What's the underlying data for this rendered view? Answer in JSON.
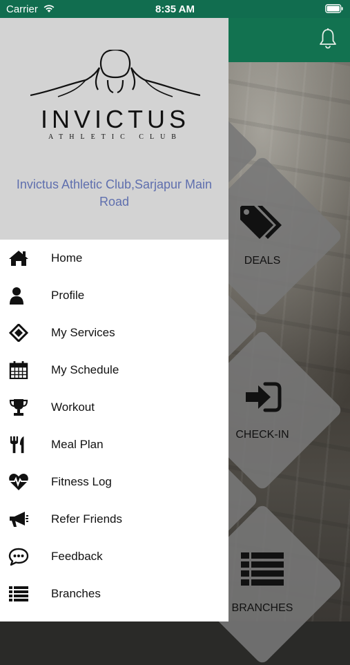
{
  "status_bar": {
    "carrier": "Carrier",
    "time": "8:35 AM"
  },
  "drawer": {
    "logo": {
      "wordmark": "INVICTUS",
      "tagline": "ATHLETIC CLUB"
    },
    "club_name": "Invictus Athletic Club,Sarjapur Main Road",
    "menu": [
      {
        "label": "Home",
        "icon": "home-icon"
      },
      {
        "label": "Profile",
        "icon": "user-icon"
      },
      {
        "label": "My Services",
        "icon": "ticket-icon"
      },
      {
        "label": "My Schedule",
        "icon": "calendar-icon"
      },
      {
        "label": "Workout",
        "icon": "trophy-icon"
      },
      {
        "label": "Meal Plan",
        "icon": "utensils-icon"
      },
      {
        "label": "Fitness Log",
        "icon": "heartbeat-icon"
      },
      {
        "label": "Refer Friends",
        "icon": "megaphone-icon"
      },
      {
        "label": "Feedback",
        "icon": "chat-icon"
      },
      {
        "label": "Branches",
        "icon": "list-icon"
      }
    ]
  },
  "background": {
    "tiles": [
      {
        "label": "DEALS",
        "icon": "tags-icon"
      },
      {
        "label": "CHECK-IN",
        "icon": "sign-in-icon"
      },
      {
        "label": "BRANCHES",
        "icon": "list-icon"
      }
    ]
  },
  "colors": {
    "header_green": "#127250",
    "statusbar_green": "#116d4f",
    "drawer_header_gray": "#d3d3d3",
    "club_name_blue": "#5f6fae"
  }
}
